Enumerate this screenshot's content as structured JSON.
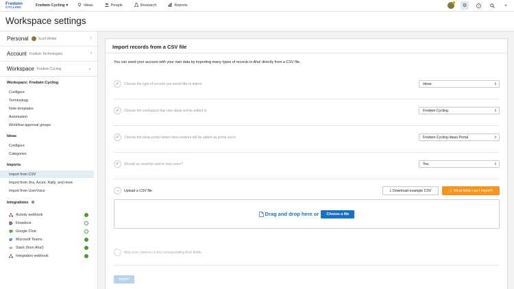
{
  "topnav": {
    "logo_line1": "Fredwin",
    "logo_line2": "CYCLING",
    "workspace_select": "Fredwin Cycling",
    "links": [
      {
        "label": "Ideas",
        "icon": "lightbulb-icon"
      },
      {
        "label": "People",
        "icon": "people-icon"
      },
      {
        "label": "Research",
        "icon": "flask-icon"
      },
      {
        "label": "Reports",
        "icon": "chart-icon"
      }
    ],
    "right_icons": [
      "avatar",
      "settings-icon",
      "help-icon",
      "search-icon",
      "plus-icon"
    ],
    "accent_color": "#1e5ca8"
  },
  "page": {
    "title": "Workspace settings"
  },
  "sidebar": {
    "rows": [
      {
        "label": "Personal",
        "sub": "Scott Whitte",
        "chev": "›"
      },
      {
        "label": "Account",
        "sub": "Fredwin Technologies",
        "chev": "›"
      },
      {
        "label": "Workspace",
        "sub": "Fredwin Cycling",
        "chev": "⌄"
      }
    ],
    "workspace_heading": "Workspace: Fredwin Cycling",
    "workspace_items": [
      "Configure",
      "Terminology",
      "Note templates",
      "Automation",
      "Workflow approval groups"
    ],
    "ideas_heading": "Ideas",
    "ideas_items": [
      "Configure",
      "Categories"
    ],
    "imports_heading": "Imports",
    "imports_items": [
      "Import from CSV",
      "Import from Jira, Azure, Rally, and more",
      "Import from UserVoice"
    ],
    "integrations_heading": "Integrations",
    "integrations": [
      {
        "label": "Activity webhook",
        "status": "on",
        "icon_color": "#c0392b"
      },
      {
        "label": "Flowdock",
        "status": "off",
        "icon_color": "#2c3e50"
      },
      {
        "label": "Google Chat",
        "status": "off",
        "icon_color": "#1e8e3e"
      },
      {
        "label": "Microsoft Teams",
        "status": "on",
        "icon_color": "#5b5fc7"
      },
      {
        "label": "Slack (from Aha!)",
        "status": "on",
        "icon_color": "#e01e5a"
      },
      {
        "label": "Integration webhook",
        "status": "on",
        "icon_color": "#c0392b"
      }
    ]
  },
  "main": {
    "title": "Import records from a CSV file",
    "intro": "You can seed your account with your own data by importing many types of records in Aha! directly from a CSV file.",
    "steps": [
      {
        "question": "Choose the type of records you would like to import",
        "value": "Ideas"
      },
      {
        "question": "Choose the workspace that new ideas will be added to",
        "value": "Fredwin Cycling"
      },
      {
        "question": "Choose the ideas portal where idea creators will be added as portal users",
        "value": "Fredwin Cycling Ideas Portal"
      },
      {
        "question": "Should an email be sent to new users?",
        "value": "Yes"
      }
    ],
    "upload_label": "Upload a CSV file",
    "download_button": "Download example CSV",
    "help_button": "What fields can I import?",
    "drop_text": "Drag and drop here or",
    "choose_button": "Choose a file",
    "map_label": "Map your columns to the corresponding Aha! fields.",
    "import_button": "Import",
    "check_color": "#4b9a2e",
    "help_color": "#f7941d",
    "primary_color": "#1570c6"
  }
}
